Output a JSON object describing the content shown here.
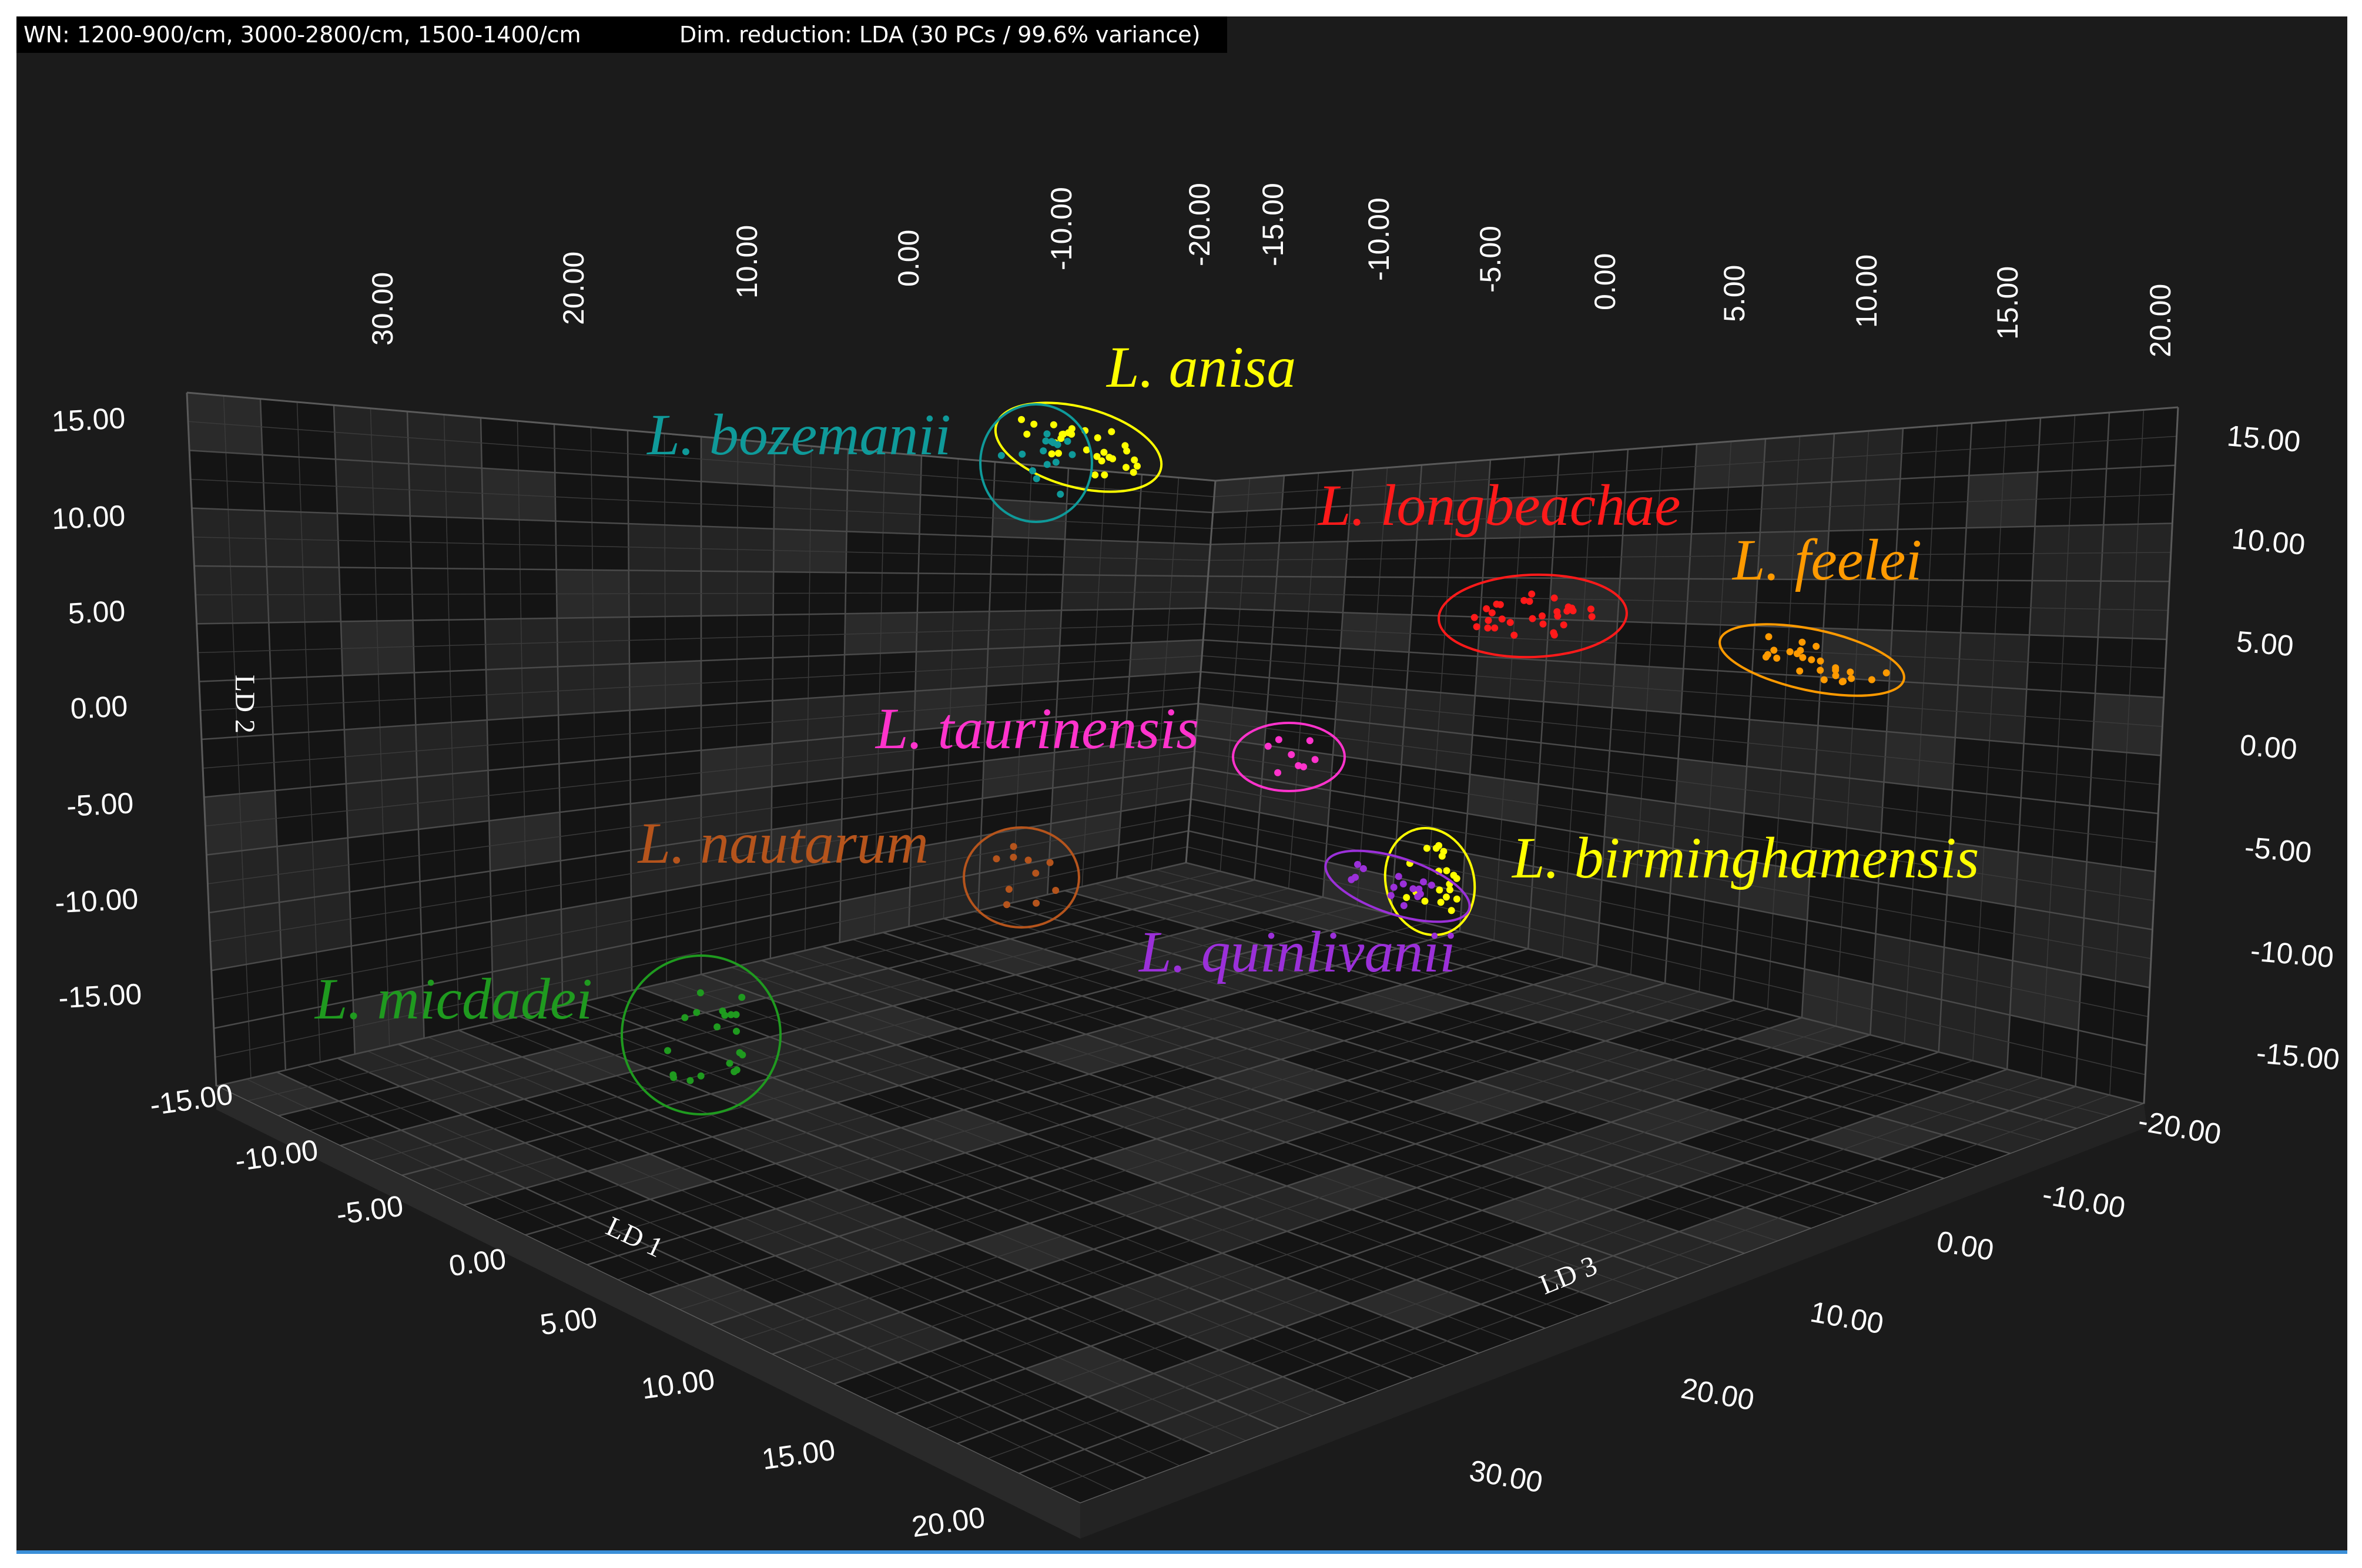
{
  "info": {
    "wavenumbers": "WN: 1200-900/cm, 3000-2800/cm, 1500-1400/cm",
    "reduction": "Dim. reduction: LDA (30 PCs / 99.6% variance)"
  },
  "chart_data": {
    "type": "scatter",
    "projection": "3d",
    "title": "",
    "axes": {
      "x": {
        "label": "LD 1",
        "ticks": [
          "-15.00",
          "-10.00",
          "-5.00",
          "0.00",
          "5.00",
          "10.00",
          "15.00",
          "20.00"
        ],
        "range": [
          -15,
          20
        ]
      },
      "y": {
        "label": "LD 2",
        "ticks": [
          "15.00",
          "10.00",
          "5.00",
          "0.00",
          "-5.00",
          "-10.00",
          "-15.00"
        ],
        "range": [
          -15,
          15
        ]
      },
      "z": {
        "label": "LD 3",
        "ticks": [
          "-20.00",
          "-10.00",
          "0.00",
          "10.00",
          "20.00",
          "30.00"
        ],
        "range": [
          -20,
          30
        ]
      },
      "back_top_ticks": [
        "30.00",
        "20.00",
        "10.00",
        "0.00",
        "-10.00",
        "-20.00"
      ],
      "side_top_ticks": [
        "-15.00",
        "-10.00",
        "-5.00",
        "0.00",
        "5.00",
        "10.00",
        "15.00",
        "20.00"
      ],
      "right_ticks": [
        "15.00",
        "10.00",
        "5.00",
        "0.00",
        "-5.00",
        "-10.00",
        "-15.00"
      ]
    },
    "grid": true,
    "series": [
      {
        "name": "L. anisa",
        "color": "#ffff00",
        "x": [
          -9,
          -7
        ],
        "y": [
          12,
          14
        ],
        "z": [
          -2,
          2
        ],
        "n": 30
      },
      {
        "name": "L. bozemanii",
        "color": "#0f9a9a",
        "x": [
          -10,
          -8
        ],
        "y": [
          10,
          14
        ],
        "z": [
          -3,
          1
        ],
        "n": 15
      },
      {
        "name": "L. longbeachae",
        "color": "#ff1a1a",
        "x": [
          10,
          14
        ],
        "y": [
          3,
          6
        ],
        "z": [
          -2,
          2
        ],
        "n": 30
      },
      {
        "name": "L. feelei",
        "color": "#ff9a00",
        "x": [
          16,
          20
        ],
        "y": [
          1,
          4
        ],
        "z": [
          -2,
          2
        ],
        "n": 25
      },
      {
        "name": "L. taurinensis",
        "color": "#ff33cc",
        "x": [
          -2,
          0
        ],
        "y": [
          -3,
          0
        ],
        "z": [
          -2,
          2
        ],
        "n": 8
      },
      {
        "name": "L. nautarum",
        "color": "#b5541c",
        "x": [
          -8,
          -5
        ],
        "y": [
          -10,
          -8
        ],
        "z": [
          5,
          9
        ],
        "n": 10
      },
      {
        "name": "L. birminghamensis",
        "color": "#ffff00",
        "x": [
          4,
          6
        ],
        "y": [
          -10,
          -6
        ],
        "z": [
          5,
          9
        ],
        "n": 20
      },
      {
        "name": "L. quinlivanii",
        "color": "#9b30d9",
        "x": [
          3,
          6
        ],
        "y": [
          -9,
          -7
        ],
        "z": [
          5,
          9
        ],
        "n": 15
      },
      {
        "name": "L. micdadei",
        "color": "#1f9a1f",
        "x": [
          -14,
          -10
        ],
        "y": [
          -15,
          -11
        ],
        "z": [
          10,
          14
        ],
        "n": 20
      }
    ]
  }
}
